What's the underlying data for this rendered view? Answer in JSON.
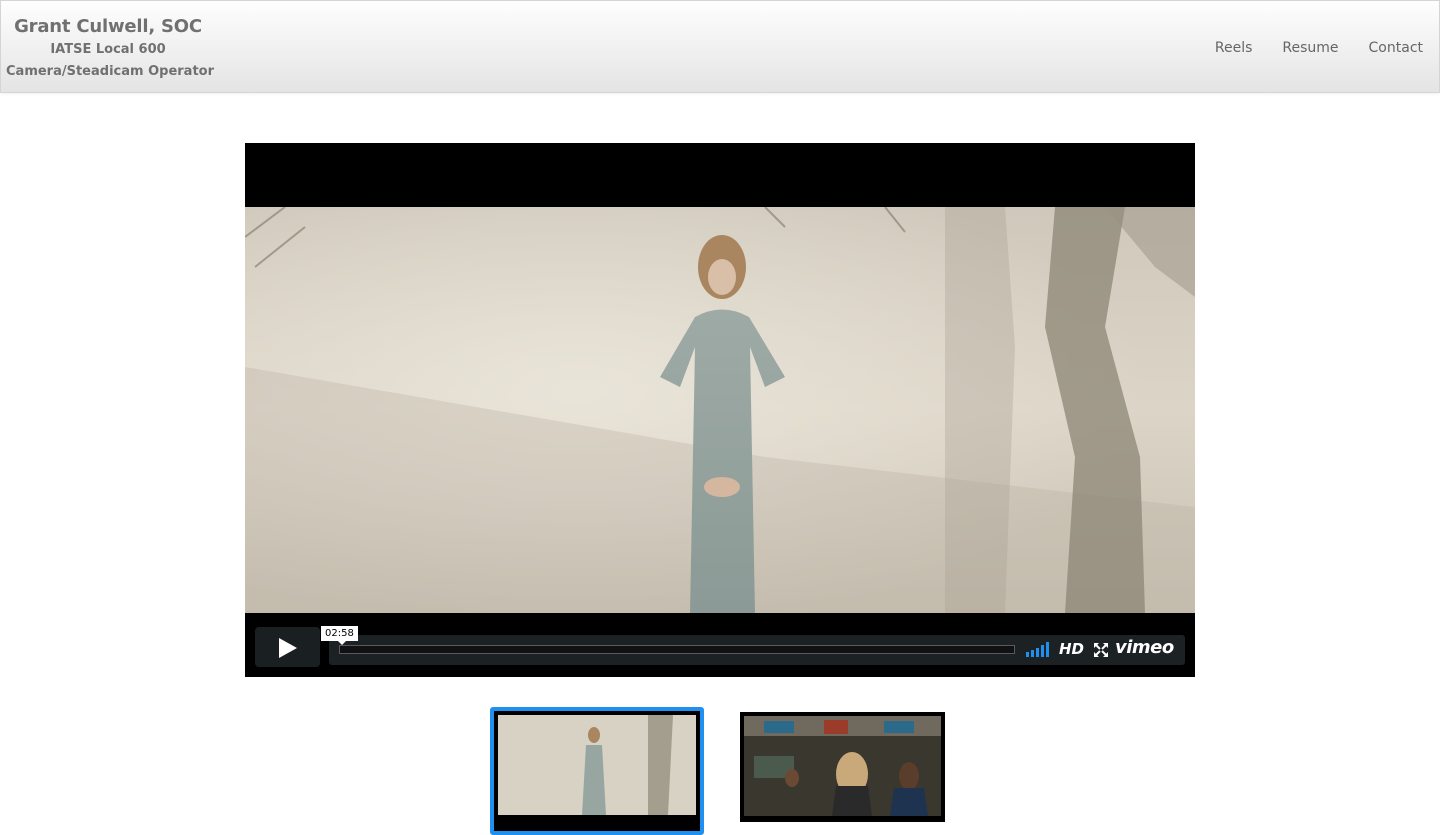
{
  "header": {
    "brand_name": "Grant Culwell, SOC",
    "union": "IATSE Local 600",
    "role": "Camera/Steadicam Operator",
    "nav": [
      {
        "label": "Reels"
      },
      {
        "label": "Resume"
      },
      {
        "label": "Contact"
      }
    ]
  },
  "player": {
    "duration": "02:58",
    "hd_label": "HD",
    "brand_label": "vimeo",
    "progress": 0.0,
    "accent_color": "#1f8ff0"
  },
  "thumbnails": [
    {
      "selected": true
    },
    {
      "selected": false
    }
  ]
}
